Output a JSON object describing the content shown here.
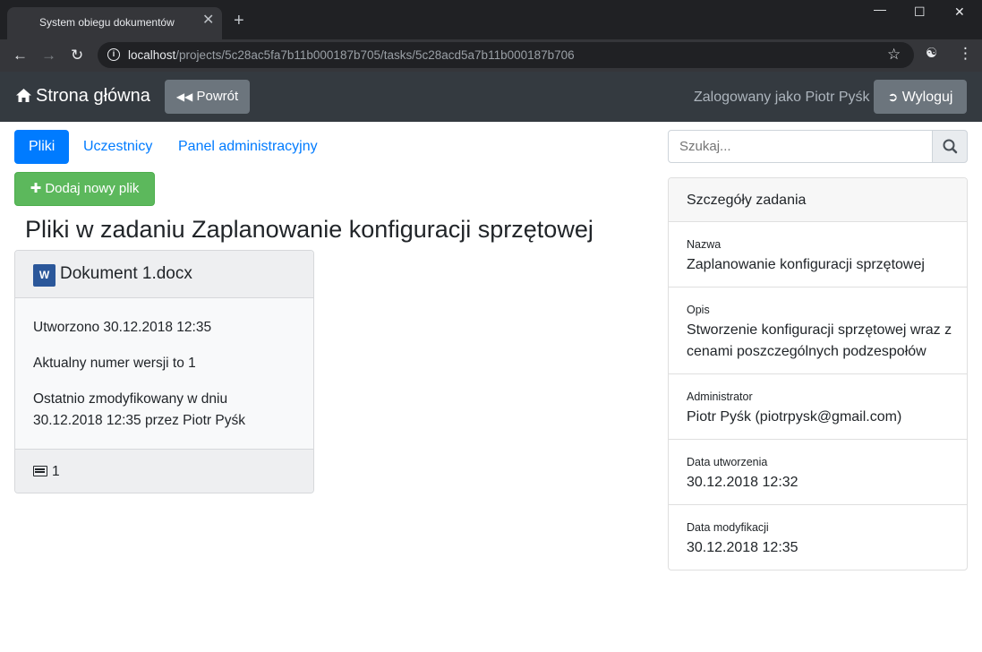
{
  "browser": {
    "tab_title": "System obiegu dokumentów",
    "close_tab": "✕",
    "new_tab": "+",
    "url_host": "localhost",
    "url_path": "/projects/5c28ac5fa7b11b000187b705/tasks/5c28acd5a7b11b000187b706"
  },
  "navbar": {
    "brand": "Strona główna",
    "back_label": "Powrót",
    "logged_in_as": "Zalogowany jako Piotr Pyśk",
    "logout_label": "Wyloguj"
  },
  "tabs": [
    {
      "label": "Pliki",
      "active": true
    },
    {
      "label": "Uczestnicy",
      "active": false
    },
    {
      "label": "Panel administracyjny",
      "active": false
    }
  ],
  "add_file_label": "Dodaj nowy plik",
  "heading": "Pliki w zadaniu Zaplanowanie konfiguracji sprzętowej",
  "files": [
    {
      "icon": "word-icon",
      "name": "Dokument 1.docx",
      "created": "Utworzono 30.12.2018 12:35",
      "version": "Aktualny numer wersji to 1",
      "modified_line1": "Ostatnio zmodyfikowany w dniu",
      "modified_line2": "30.12.2018 12:35 przez Piotr Pyśk",
      "versions_count": "1"
    }
  ],
  "search": {
    "placeholder": "Szukaj..."
  },
  "details": {
    "title": "Szczegóły zadania",
    "rows": [
      {
        "label": "Nazwa",
        "value": "Zaplanowanie konfiguracji sprzętowej"
      },
      {
        "label": "Opis",
        "value": "Stworzenie konfiguracji sprzętowej wraz z cenami poszczególnych podzespołów"
      },
      {
        "label": "Administrator",
        "value": "Piotr Pyśk (piotrpysk@gmail.com)"
      },
      {
        "label": "Data utworzenia",
        "value": "30.12.2018 12:32"
      },
      {
        "label": "Data modyfikacji",
        "value": "30.12.2018 12:35"
      }
    ]
  },
  "colors": {
    "primary": "#007bff",
    "success": "#5cb85c",
    "navbar": "#343a40",
    "secondary": "#6c757d"
  }
}
